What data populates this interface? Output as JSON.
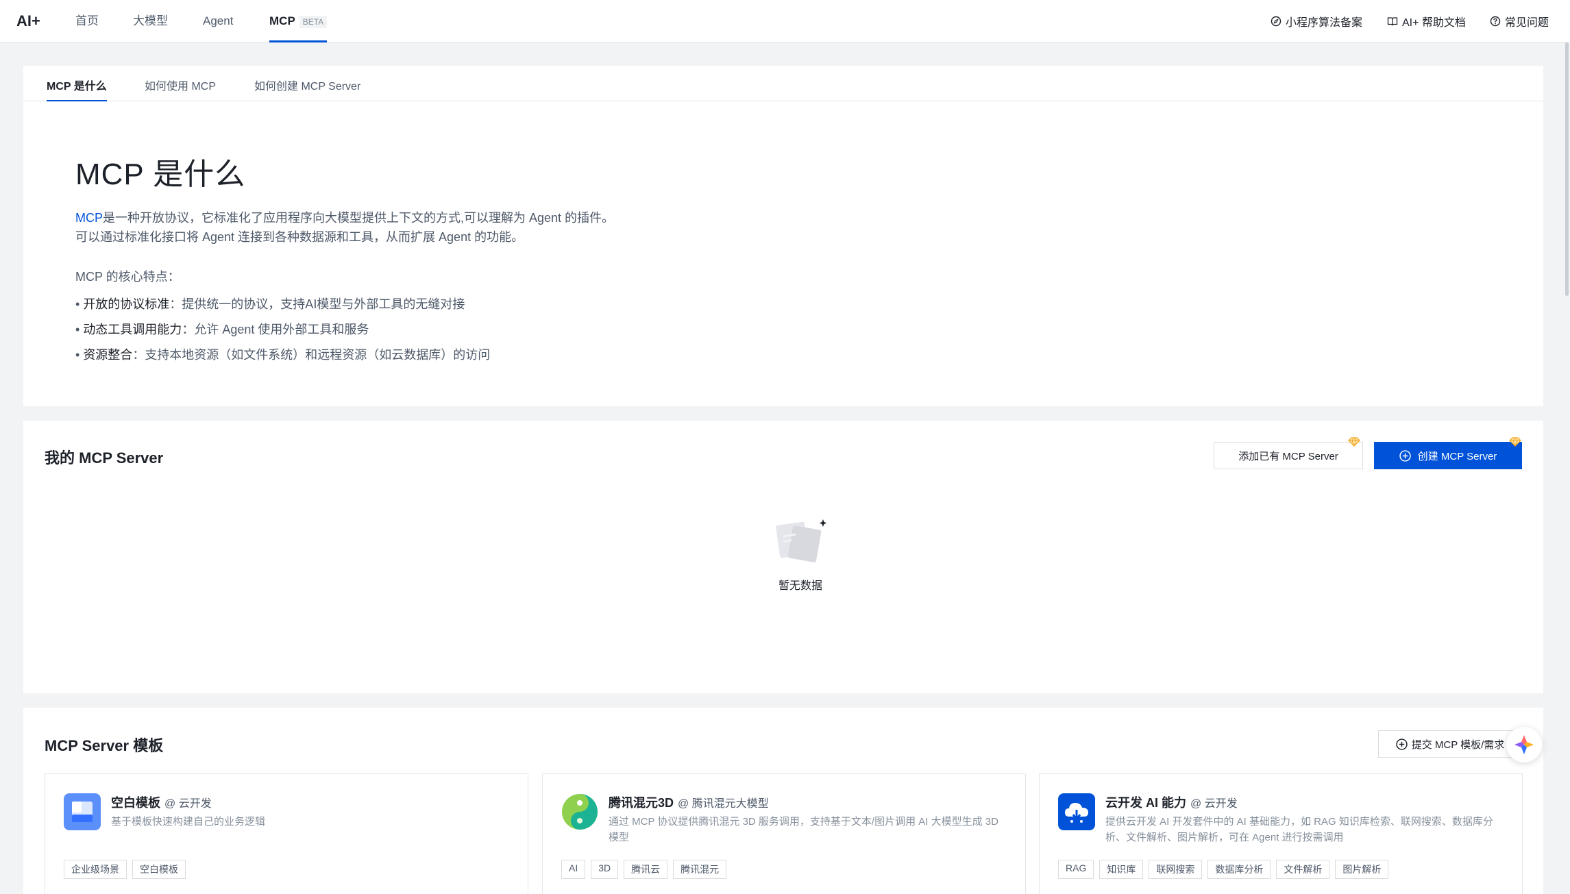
{
  "nav": {
    "logo": "AI+",
    "items": [
      "首页",
      "大模型",
      "Agent",
      "MCP"
    ],
    "beta": "BETA",
    "right": [
      "小程序算法备案",
      "AI+ 帮助文档",
      "常见问题"
    ]
  },
  "tabs": [
    "MCP 是什么",
    "如何使用 MCP",
    "如何创建 MCP Server"
  ],
  "intro": {
    "heading": "MCP 是什么",
    "link": "MCP",
    "line1_rest": "是一种开放协议，它标准化了应用程序向大模型提供上下文的方式,可以理解为 Agent 的插件。",
    "line2": "可以通过标准化接口将 Agent 连接到各种数据源和工具，从而扩展 Agent 的功能。",
    "features_title": "MCP 的核心特点：",
    "features": [
      {
        "name": "开放的协议标准",
        "desc": "提供统一的协议，支持AI模型与外部工具的无缝对接"
      },
      {
        "name": "动态工具调用能力",
        "desc": "允许 Agent 使用外部工具和服务"
      },
      {
        "name": "资源整合",
        "desc": "支持本地资源（如文件系统）和远程资源（如云数据库）的访问"
      }
    ]
  },
  "my_servers": {
    "title": "我的 MCP Server",
    "add_button": "添加已有 MCP Server",
    "create_button": "创建 MCP Server",
    "empty_text": "暂无数据"
  },
  "templates": {
    "title": "MCP Server 模板",
    "submit_button": "提交 MCP 模板/需求",
    "items": [
      {
        "name": "空白模板",
        "owner": "@ 云开发",
        "desc": "基于模板快速构建自己的业务逻辑",
        "tags": [
          "企业级场景",
          "空白模板"
        ]
      },
      {
        "name": "腾讯混元3D",
        "owner": "@ 腾讯混元大模型",
        "desc": "通过 MCP 协议提供腾讯混元 3D 服务调用，支持基于文本/图片调用 AI 大模型生成 3D 模型",
        "tags": [
          "AI",
          "3D",
          "腾讯云",
          "腾讯混元"
        ]
      },
      {
        "name": "云开发 AI 能力",
        "owner": "@ 云开发",
        "desc": "提供云开发 AI 开发套件中的 AI 基础能力，如 RAG 知识库检索、联网搜索、数据库分析、文件解析、图片解析，可在 Agent 进行按需调用",
        "tags": [
          "RAG",
          "知识库",
          "联网搜索",
          "数据库分析",
          "文件解析",
          "图片解析"
        ]
      }
    ]
  },
  "colors": {
    "primary": "#0052d9",
    "background": "#f2f3f5",
    "gem": "#f5a623"
  }
}
